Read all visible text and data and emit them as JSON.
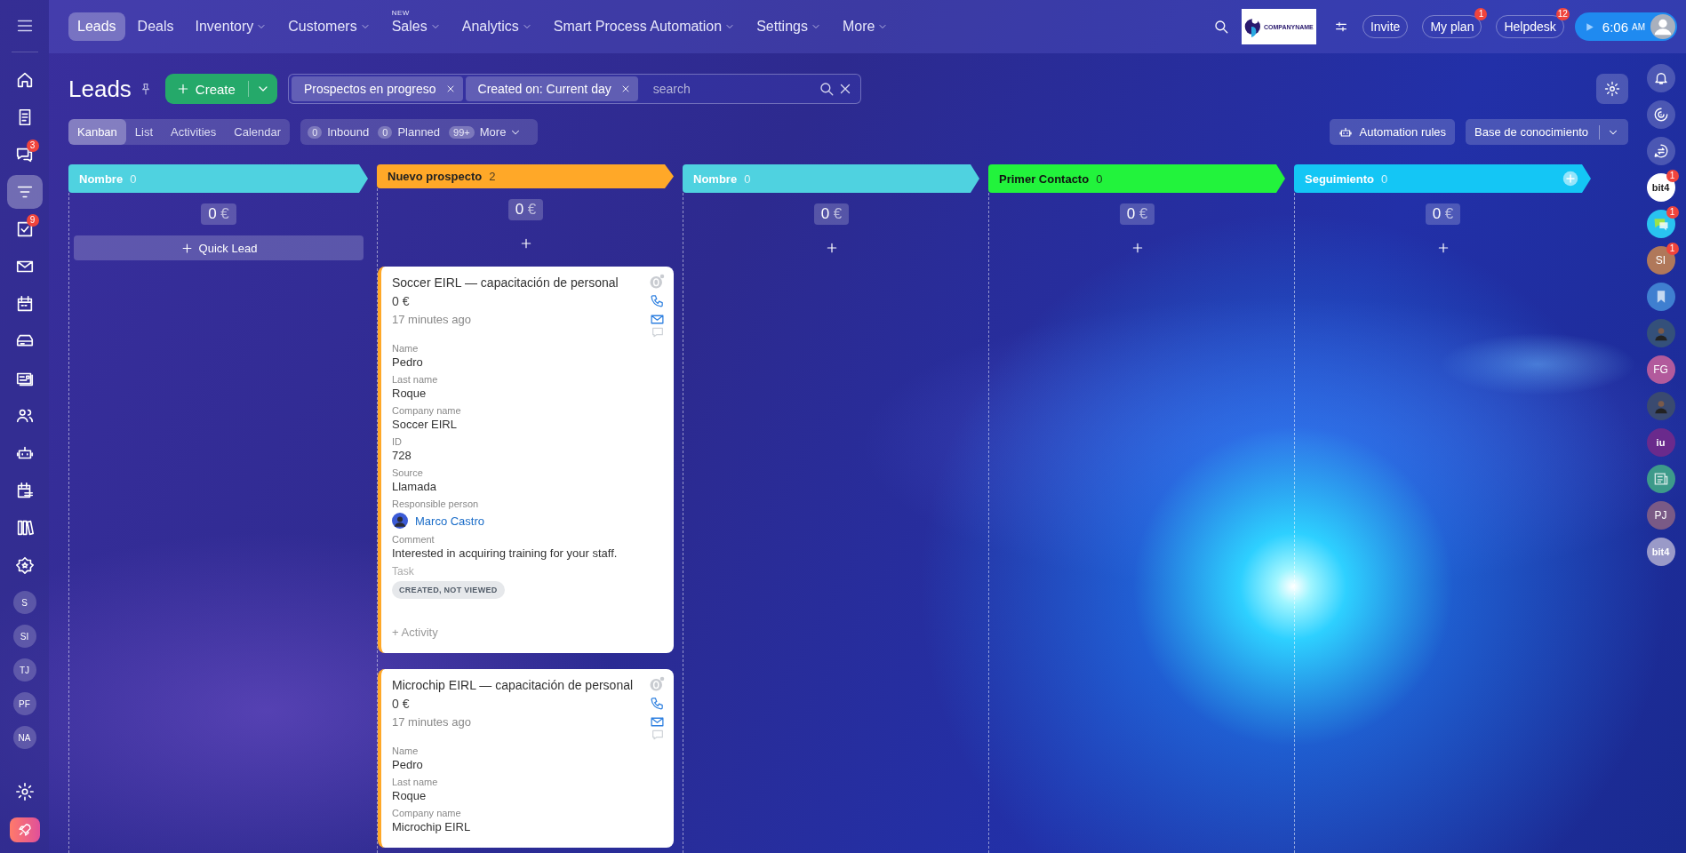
{
  "left_sidebar": {
    "items": [
      {
        "kind": "icon",
        "selected": false
      },
      {
        "kind": "icon",
        "selected": false
      },
      {
        "kind": "icon",
        "selected": false,
        "badge": "3"
      },
      {
        "kind": "icon",
        "selected": true
      },
      {
        "kind": "icon",
        "selected": false,
        "badge": "9"
      },
      {
        "kind": "icon",
        "selected": false
      },
      {
        "kind": "icon",
        "selected": false
      },
      {
        "kind": "icon",
        "selected": false
      },
      {
        "kind": "icon",
        "selected": false
      },
      {
        "kind": "icon",
        "selected": false
      },
      {
        "kind": "icon",
        "selected": false
      },
      {
        "kind": "icon",
        "selected": false
      },
      {
        "kind": "icon",
        "selected": false
      },
      {
        "kind": "icon",
        "selected": false
      },
      {
        "kind": "initials",
        "label": "S"
      },
      {
        "kind": "initials",
        "label": "SI"
      },
      {
        "kind": "initials",
        "label": "TJ"
      },
      {
        "kind": "initials",
        "label": "PF"
      },
      {
        "kind": "initials",
        "label": "NA"
      }
    ]
  },
  "nav": {
    "items": [
      {
        "label": "Leads",
        "selected": true,
        "dropdown": false
      },
      {
        "label": "Deals",
        "selected": false,
        "dropdown": false
      },
      {
        "label": "Inventory",
        "selected": false,
        "dropdown": true
      },
      {
        "label": "Customers",
        "selected": false,
        "dropdown": true
      },
      {
        "label": "Sales",
        "selected": false,
        "dropdown": true,
        "tag": "NEW"
      },
      {
        "label": "Analytics",
        "selected": false,
        "dropdown": true
      },
      {
        "label": "Smart Process Automation",
        "selected": false,
        "dropdown": true
      },
      {
        "label": "Settings",
        "selected": false,
        "dropdown": true
      },
      {
        "label": "More",
        "selected": false,
        "dropdown": true
      }
    ]
  },
  "header": {
    "logo_text": "COMPANYNAME",
    "buttons": [
      {
        "label": "Invite"
      },
      {
        "label": "My plan",
        "badge": "1"
      },
      {
        "label": "Helpdesk",
        "badge": "12"
      }
    ],
    "time": "6:06",
    "meridiem": "AM"
  },
  "page": {
    "title": "Leads",
    "create_label": "Create",
    "filters": [
      {
        "label": "Prospectos en progreso"
      },
      {
        "label": "Created on: Current day"
      }
    ],
    "search": {
      "placeholder": "search"
    },
    "views": [
      {
        "label": "Kanban",
        "selected": true
      },
      {
        "label": "List",
        "selected": false
      },
      {
        "label": "Activities",
        "selected": false
      },
      {
        "label": "Calendar",
        "selected": false
      }
    ],
    "counters": [
      {
        "count": "0",
        "label": "Inbound"
      },
      {
        "count": "0",
        "label": "Planned"
      },
      {
        "count": "99+",
        "label": "More"
      }
    ],
    "automation_label": "Automation rules",
    "knowledge_label": "Base de conocimiento"
  },
  "columns": [
    {
      "name": "Nombre",
      "count": "0",
      "color": "#4fd2e0",
      "sum": "0",
      "currency": "€",
      "add_label": "Quick Lead"
    },
    {
      "name": "Nuevo prospecto",
      "count": "2",
      "color": "#ffa828",
      "sum": "0",
      "currency": "€",
      "cards": [
        {
          "title": "Soccer EIRL — capacitación de personal",
          "amount": "0 €",
          "time": "17 minutes ago",
          "fields": [
            {
              "kind": "text",
              "label": "Name",
              "value": "Pedro"
            },
            {
              "kind": "text",
              "label": "Last name",
              "value": "Roque"
            },
            {
              "kind": "text",
              "label": "Company name",
              "value": "Soccer EIRL"
            },
            {
              "kind": "text",
              "label": "ID",
              "value": "728"
            },
            {
              "kind": "text",
              "label": "Source",
              "value": "Llamada"
            },
            {
              "kind": "person",
              "label": "Responsible person",
              "value": "Marco Castro"
            },
            {
              "kind": "text",
              "label": "Comment",
              "value": "Interested in acquiring training for your staff."
            },
            {
              "kind": "badge",
              "label": "Task",
              "value": "CREATED, NOT VIEWED"
            }
          ],
          "activity": "+ Activity"
        },
        {
          "title": "Microchip EIRL — capacitación de personal",
          "amount": "0 €",
          "time": "17 minutes ago",
          "fields": [
            {
              "kind": "text",
              "label": "Name",
              "value": "Pedro"
            },
            {
              "kind": "text",
              "label": "Last name",
              "value": "Roque"
            },
            {
              "kind": "text",
              "label": "Company name",
              "value": "Microchip EIRL"
            }
          ]
        }
      ]
    },
    {
      "name": "Nombre",
      "count": "0",
      "color": "#4fd2e0",
      "sum": "0",
      "currency": "€"
    },
    {
      "name": "Primer Contacto",
      "count": "0",
      "color": "#22f33c",
      "sum": "0",
      "currency": "€"
    },
    {
      "name": "Seguimiento",
      "count": "0",
      "color": "#14c6f5",
      "sum": "0",
      "currency": "€",
      "add_stage": true
    }
  ],
  "right_sidebar": {
    "items": [
      {
        "kind": "icon"
      },
      {
        "kind": "icon"
      },
      {
        "kind": "icon"
      },
      {
        "kind": "logo",
        "label": "bit4",
        "color": "#ffffff",
        "badge": "1"
      },
      {
        "kind": "chat",
        "color": "#29c3f0",
        "badge": "1"
      },
      {
        "kind": "initials",
        "label": "SI",
        "color": "#b0785a",
        "badge": "1"
      },
      {
        "kind": "bookmark",
        "color": "#3f7fd0"
      },
      {
        "kind": "photo",
        "color": "#34507a"
      },
      {
        "kind": "initials",
        "label": "FG",
        "color": "#b25a9c"
      },
      {
        "kind": "photo",
        "color": "#3a4a70"
      },
      {
        "kind": "logo",
        "label": "iu",
        "color": "#6a2a8c"
      },
      {
        "kind": "news",
        "color": "#3d9a8a"
      },
      {
        "kind": "initials",
        "label": "PJ",
        "color": "#7a5a86"
      },
      {
        "kind": "logo",
        "label": "bit4",
        "color": "#9a9ac8"
      }
    ]
  }
}
